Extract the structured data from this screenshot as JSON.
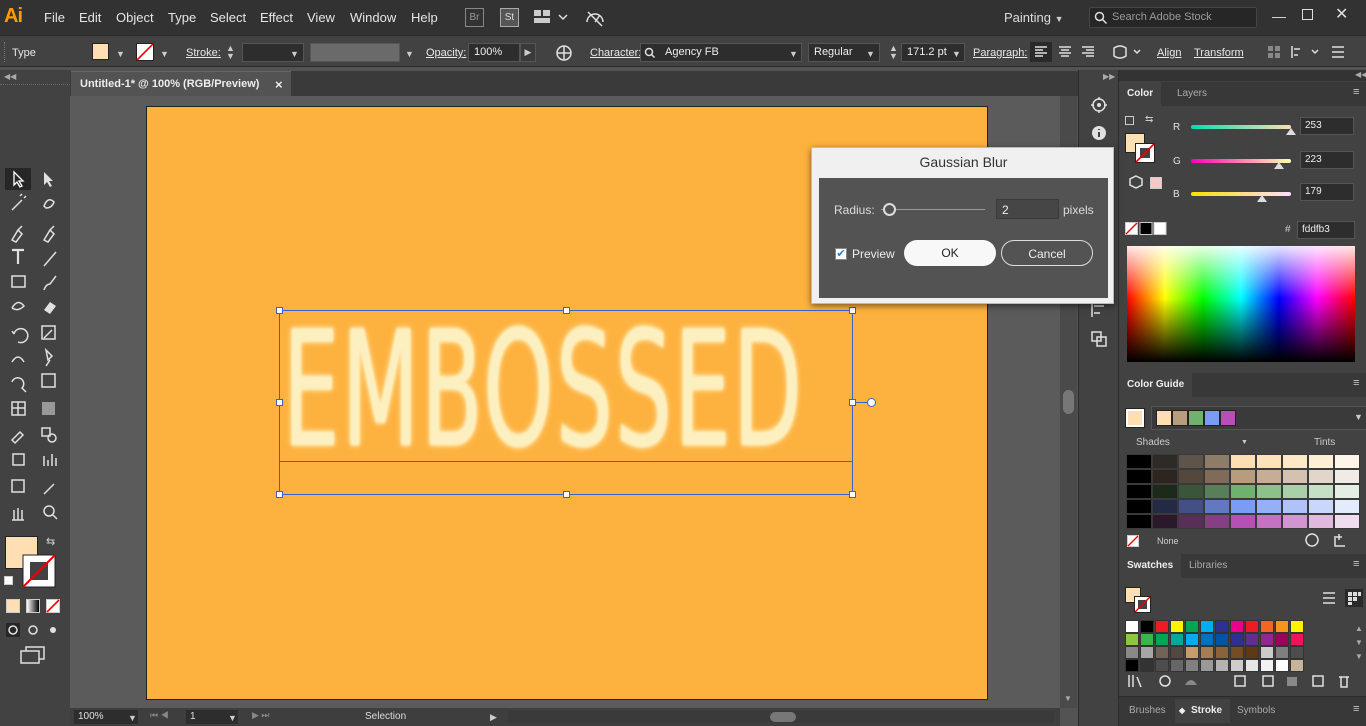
{
  "app": {
    "logo": "Ai"
  },
  "menu": [
    "File",
    "Edit",
    "Object",
    "Type",
    "Select",
    "Effect",
    "View",
    "Window",
    "Help"
  ],
  "menu_icons": {
    "bridge": "Br",
    "stock": "St"
  },
  "workspace": "Painting",
  "search": {
    "placeholder": "Search Adobe Stock"
  },
  "control": {
    "type_label": "Type",
    "stroke_label": "Stroke:",
    "opacity_label": "Opacity:",
    "opacity_value": "100%",
    "character_label": "Character:",
    "font_name": "Agency FB",
    "font_style": "Regular",
    "font_size": "171.2 pt",
    "paragraph_label": "Paragraph:",
    "align_label": "Align",
    "transform_label": "Transform"
  },
  "document": {
    "tab_title": "Untitled-1* @ 100% (RGB/Preview)",
    "close": "×"
  },
  "canvas": {
    "text": "EMBOSSED",
    "artboard_color": "#fdb13f",
    "text_color": "#fdf0c0"
  },
  "status": {
    "zoom": "100%",
    "page": "1",
    "tool": "Selection"
  },
  "dialog": {
    "title": "Gaussian Blur",
    "radius_label": "Radius:",
    "radius_value": "2",
    "radius_unit": "pixels",
    "radius_fraction": 0.08,
    "preview_label": "Preview",
    "preview_checked": true,
    "ok": "OK",
    "cancel": "Cancel"
  },
  "color_panel": {
    "tabs": [
      "Color",
      "Layers"
    ],
    "r_label": "R",
    "r": "253",
    "g_label": "G",
    "g": "223",
    "b_label": "B",
    "b": "179",
    "hash": "#",
    "hex": "fddfb3",
    "fill": "#fddfb3"
  },
  "color_guide": {
    "tab": "Color Guide",
    "shades": "Shades",
    "tints": "Tints",
    "none_label": "None",
    "harmony": [
      "#fddfb3",
      "#b89c7e",
      "#6fb26f",
      "#7a9cf5",
      "#b650b4"
    ],
    "rows": [
      [
        "#000000",
        "#2e2a26",
        "#5e5449",
        "#8c7c68",
        "#fddfb3",
        "#fde3bc",
        "#fde8c8",
        "#fdeed6",
        "#fdf5e8"
      ],
      [
        "#000000",
        "#2c2520",
        "#54473b",
        "#7f6b58",
        "#b89c7e",
        "#c6ae96",
        "#d4c2b0",
        "#e2d6ca",
        "#f0ebe4"
      ],
      [
        "#000000",
        "#1c2a1c",
        "#3a553a",
        "#57805a",
        "#6fb26f",
        "#8cc18c",
        "#a9d0a9",
        "#c6e0c6",
        "#e3efe3"
      ],
      [
        "#000000",
        "#232a44",
        "#435085",
        "#6079c2",
        "#7a9cf5",
        "#94b0f7",
        "#afc3f9",
        "#c9d7fb",
        "#e4ebfd"
      ],
      [
        "#000000",
        "#2c182c",
        "#572f57",
        "#853f82",
        "#b650b4",
        "#c473c2",
        "#d196d0",
        "#dfb9de",
        "#efdcee"
      ]
    ]
  },
  "swatches": {
    "tabs": [
      "Swatches",
      "Libraries"
    ],
    "row1": [
      "#ffffff",
      "#000000",
      "#ed1c24",
      "#fff200",
      "#00a651",
      "#00aeef",
      "#2e3192",
      "#ec008c",
      "#ed1c24",
      "#f26522",
      "#f7941d",
      "#fff200"
    ],
    "row2": [
      "#8dc63f",
      "#39b54a",
      "#00a651",
      "#00a99d",
      "#00aeef",
      "#0072bc",
      "#0054a6",
      "#2e3192",
      "#662d91",
      "#92278f",
      "#9e005d",
      "#ed145b"
    ],
    "row3": [
      "#898989",
      "#a6a6a6",
      "#736357",
      "#534741",
      "#c69c6d",
      "#a67c52",
      "#8c6239",
      "#754c24",
      "#603913",
      "#cccccc",
      "#7f7f7f",
      "#4d4d4d"
    ],
    "row4": [
      "#000000",
      "#333333",
      "#4d4d4d",
      "#666666",
      "#808080",
      "#999999",
      "#b3b3b3",
      "#cccccc",
      "#e6e6e6",
      "#f2f2f2",
      "#ffffff",
      "#c8b49a"
    ]
  },
  "bottom_tabs": [
    "Brushes",
    "Stroke",
    "Symbols"
  ]
}
